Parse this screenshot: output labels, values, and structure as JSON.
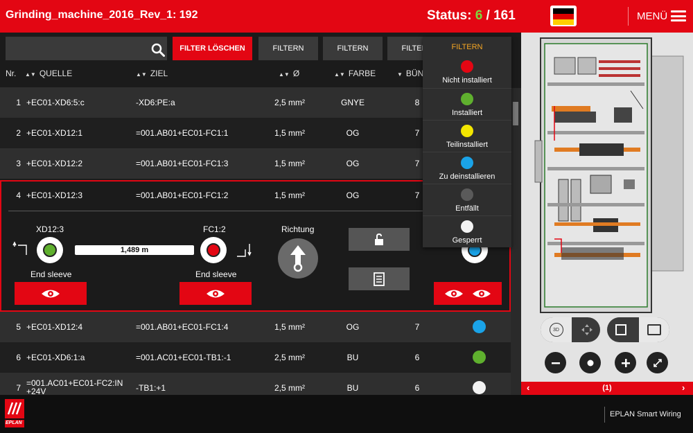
{
  "app": {
    "title": "Grinding_machine_2016_Rev_1: 192",
    "status_label": "Status:",
    "status_installed": "6",
    "status_separator": "/",
    "status_total": "161",
    "menu_label": "MENÜ",
    "footer_text": "EPLAN Smart Wiring",
    "logo_text": "EPLAN"
  },
  "toolbar": {
    "search_value": "",
    "clear_filter": "FILTER LÖSCHEN",
    "filters": [
      "FILTERN",
      "FILTERN",
      "FILTERN"
    ]
  },
  "table": {
    "headers": {
      "nr": "Nr.",
      "quelle": "QUELLE",
      "ziel": "ZIEL",
      "diameter": "Ø",
      "farbe": "FARBE",
      "buendel": "BÜN"
    },
    "rows": [
      {
        "nr": "1",
        "quelle": "+EC01-XD6:5:c",
        "ziel": "-XD6:PE:a",
        "querschnitt": "2,5 mm²",
        "farbe": "GNYE",
        "buendel": "8",
        "status_color": ""
      },
      {
        "nr": "2",
        "quelle": "+EC01-XD12:1",
        "ziel": "=001.AB01+EC01-FC1:1",
        "querschnitt": "1,5 mm²",
        "farbe": "OG",
        "buendel": "7",
        "status_color": ""
      },
      {
        "nr": "3",
        "quelle": "+EC01-XD12:2",
        "ziel": "=001.AB01+EC01-FC1:3",
        "querschnitt": "1,5 mm²",
        "farbe": "OG",
        "buendel": "7",
        "status_color": ""
      },
      {
        "nr": "4",
        "quelle": "+EC01-XD12:3",
        "ziel": "=001.AB01+EC01-FC1:2",
        "querschnitt": "1,5 mm²",
        "farbe": "OG",
        "buendel": "7",
        "status_color": ""
      },
      {
        "nr": "5",
        "quelle": "+EC01-XD12:4",
        "ziel": "=001.AB01+EC01-FC1:4",
        "querschnitt": "1,5 mm²",
        "farbe": "OG",
        "buendel": "7",
        "status_color": "#1aa3e8"
      },
      {
        "nr": "6",
        "quelle": "+EC01-XD6:1:a",
        "ziel": "=001.AC01+EC01-TB1:-1",
        "querschnitt": "2,5 mm²",
        "farbe": "BU",
        "buendel": "6",
        "status_color": "#5fb02e"
      },
      {
        "nr": "7",
        "quelle": "=001.AC01+EC01-FC2:IN +24V",
        "ziel": "-TB1:+1",
        "querschnitt": "2,5 mm²",
        "farbe": "BU",
        "buendel": "6",
        "status_color": "#f2f2f2"
      }
    ]
  },
  "detail": {
    "source_label": "XD12:3",
    "target_label": "FC1:2",
    "source_end": "End sleeve",
    "target_end": "End sleeve",
    "length": "1,489 m",
    "direction_label": "Richtung",
    "source_status_color": "#5fb02e",
    "target_status_color": "#e30613",
    "wire_status_color": "#1aa3e8"
  },
  "filter_menu": {
    "title": "FILTERN",
    "items": [
      {
        "label": "Nicht installiert",
        "color": "#e30613"
      },
      {
        "label": "Installiert",
        "color": "#5fb02e"
      },
      {
        "label": "Teilinstalliert",
        "color": "#f2e600"
      },
      {
        "label": "Zu deinstallieren",
        "color": "#1aa3e8"
      },
      {
        "label": "Entfällt",
        "color": "#5a5a5a"
      },
      {
        "label": "Gesperrt",
        "color": "#f2f2f2"
      }
    ]
  },
  "viewer": {
    "page_indicator": "(1)",
    "view_3d_label": "3D"
  },
  "colors": {
    "accent": "#e30613",
    "installed": "#7bd93e"
  }
}
